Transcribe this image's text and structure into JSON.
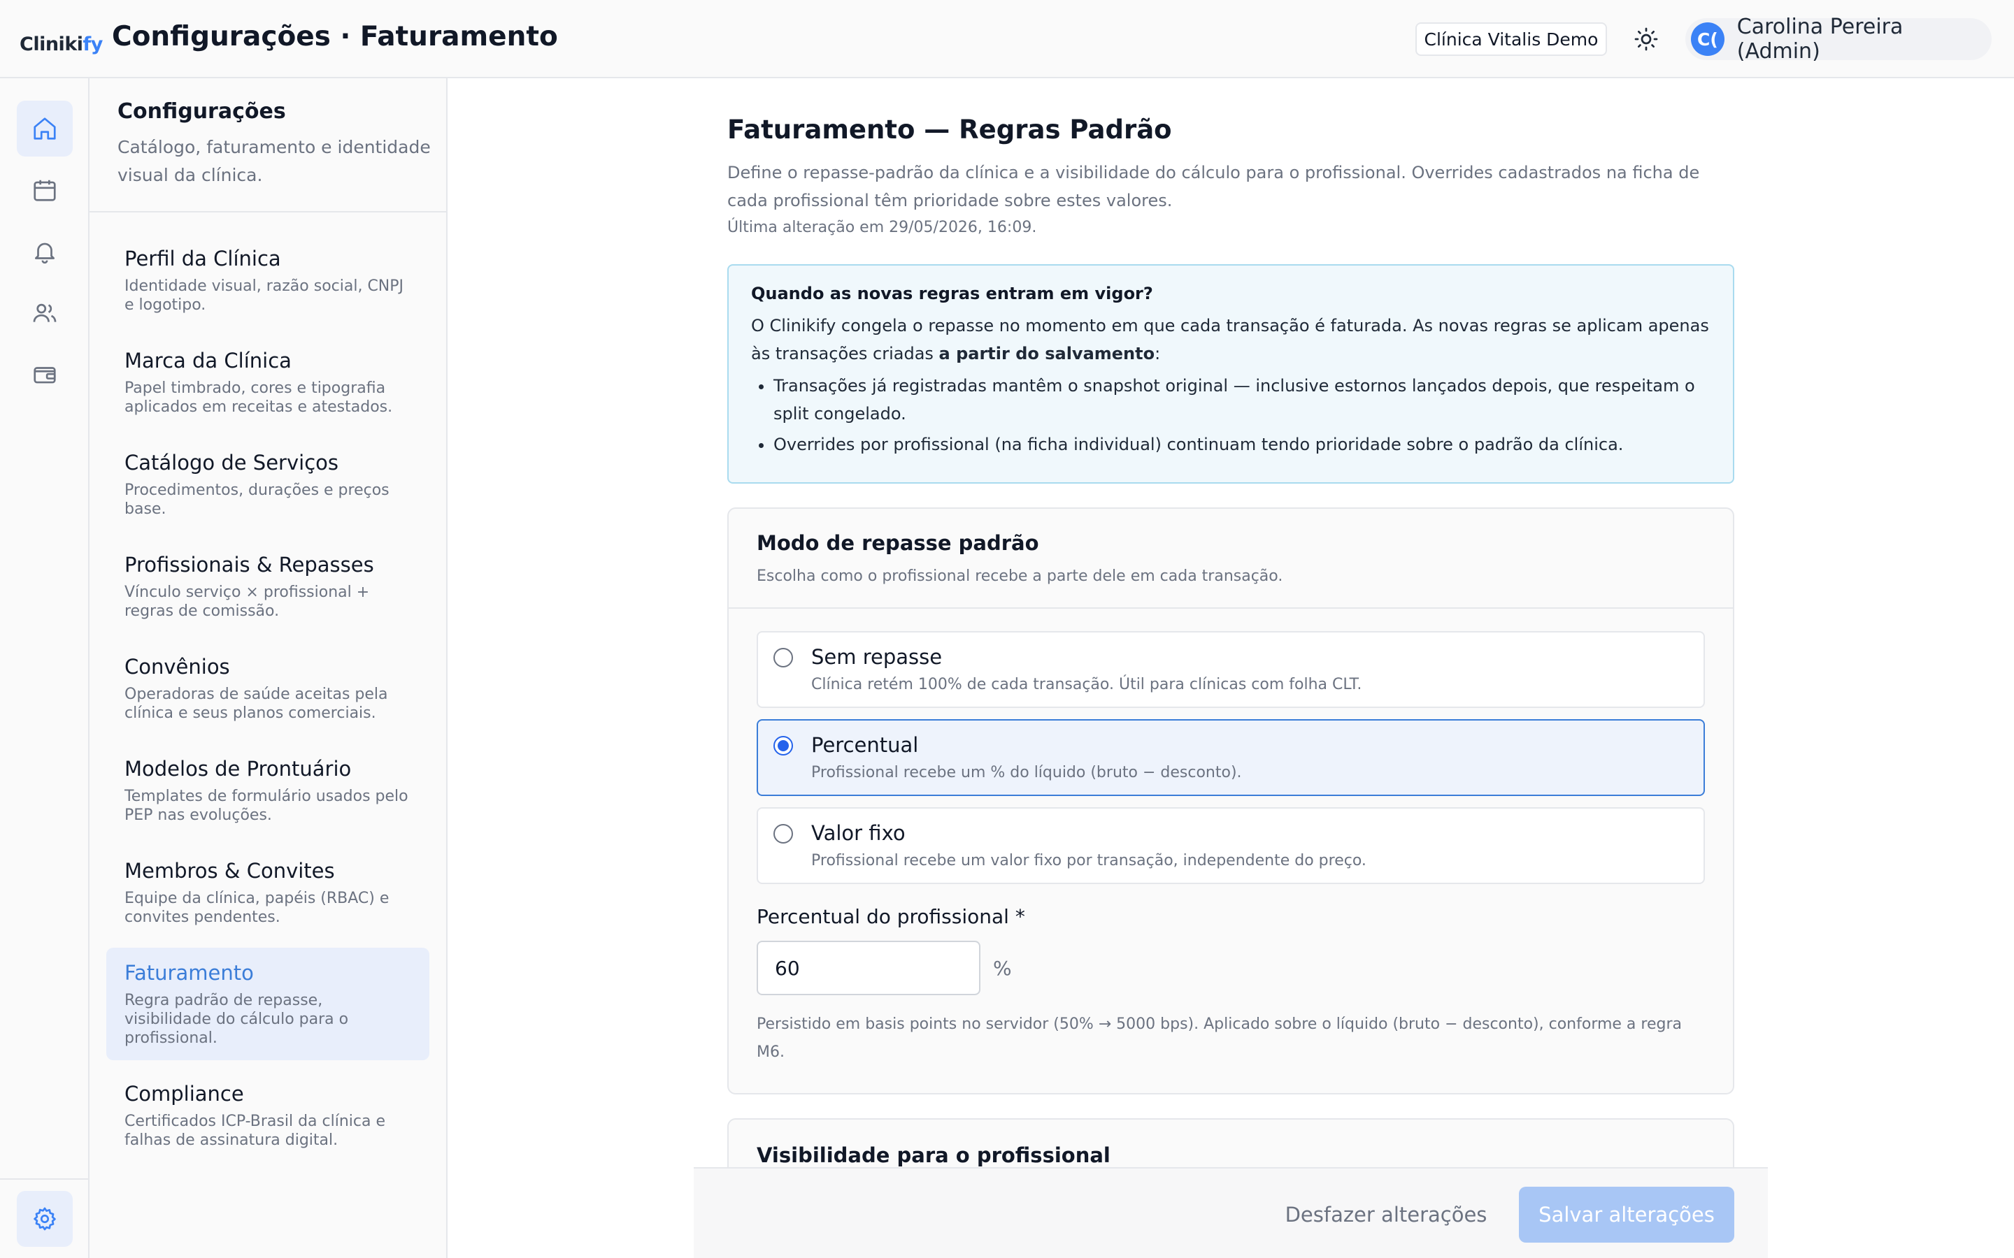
{
  "app": {
    "logo_text": "Clinikify",
    "page_title": "Configurações · Faturamento",
    "clinic_name": "Clínica Vitalis Demo",
    "user": {
      "initials": "C(",
      "name": "Carolina Pereira (Admin)"
    }
  },
  "rail": {
    "items": [
      {
        "icon": "home-icon",
        "active": true
      },
      {
        "icon": "calendar-icon",
        "active": false
      },
      {
        "icon": "bell-icon",
        "active": false
      },
      {
        "icon": "users-icon",
        "active": false
      },
      {
        "icon": "wallet-icon",
        "active": false
      }
    ],
    "bottom_icon": "gear-icon"
  },
  "settings_nav": {
    "title": "Configurações",
    "subtitle": "Catálogo, faturamento e identidade visual da clínica.",
    "items": [
      {
        "label": "Perfil da Clínica",
        "desc": "Identidade visual, razão social, CNPJ e logotipo."
      },
      {
        "label": "Marca da Clínica",
        "desc": "Papel timbrado, cores e tipografia aplicados em receitas e atestados."
      },
      {
        "label": "Catálogo de Serviços",
        "desc": "Procedimentos, durações e preços base."
      },
      {
        "label": "Profissionais & Repasses",
        "desc": "Vínculo serviço × profissional + regras de comissão."
      },
      {
        "label": "Convênios",
        "desc": "Operadoras de saúde aceitas pela clínica e seus planos comerciais."
      },
      {
        "label": "Modelos de Prontuário",
        "desc": "Templates de formulário usados pelo PEP nas evoluções."
      },
      {
        "label": "Membros & Convites",
        "desc": "Equipe da clínica, papéis (RBAC) e convites pendentes."
      },
      {
        "label": "Faturamento",
        "desc": "Regra padrão de repasse, visibilidade do cálculo para o profissional."
      },
      {
        "label": "Compliance",
        "desc": "Certificados ICP-Brasil da clínica e falhas de assinatura digital."
      }
    ],
    "active_index": 7
  },
  "main": {
    "heading": "Faturamento — Regras Padrão",
    "description": "Define o repasse-padrão da clínica e a visibilidade do cálculo para o profissional. Overrides cadastrados na ficha de cada profissional têm prioridade sobre estes valores.",
    "last_change": "Última alteração em 29/05/2026, 16:09.",
    "info": {
      "title": "Quando as novas regras entram em vigor?",
      "text_before": "O Clinikify congela o repasse no momento em que cada transação é faturada. As novas regras se aplicam apenas às transações criadas ",
      "text_bold": "a partir do salvamento",
      "text_after": ":",
      "bullets": [
        "Transações já registradas mantêm o snapshot original — inclusive estornos lançados depois, que respeitam o split congelado.",
        "Overrides por profissional (na ficha individual) continuam tendo prioridade sobre o padrão da clínica."
      ]
    },
    "mode_card": {
      "title": "Modo de repasse padrão",
      "subtitle": "Escolha como o profissional recebe a parte dele em cada transação.",
      "options": [
        {
          "label": "Sem repasse",
          "desc": "Clínica retém 100% de cada transação. Útil para clínicas com folha CLT.",
          "selected": false
        },
        {
          "label": "Percentual",
          "desc": "Profissional recebe um % do líquido (bruto − desconto).",
          "selected": true
        },
        {
          "label": "Valor fixo",
          "desc": "Profissional recebe um valor fixo por transação, independente do preço.",
          "selected": false
        }
      ],
      "field_label": "Percentual do profissional *",
      "field_value": "60",
      "field_suffix": "%",
      "field_hint": "Persistido em basis points no servidor (50% → 5000 bps). Aplicado sobre o líquido (bruto − desconto), conforme a regra M6."
    },
    "visibility_card": {
      "title": "Visibilidade para o profissional"
    }
  },
  "actions": {
    "undo_label": "Desfazer alterações",
    "save_label": "Salvar alterações"
  }
}
